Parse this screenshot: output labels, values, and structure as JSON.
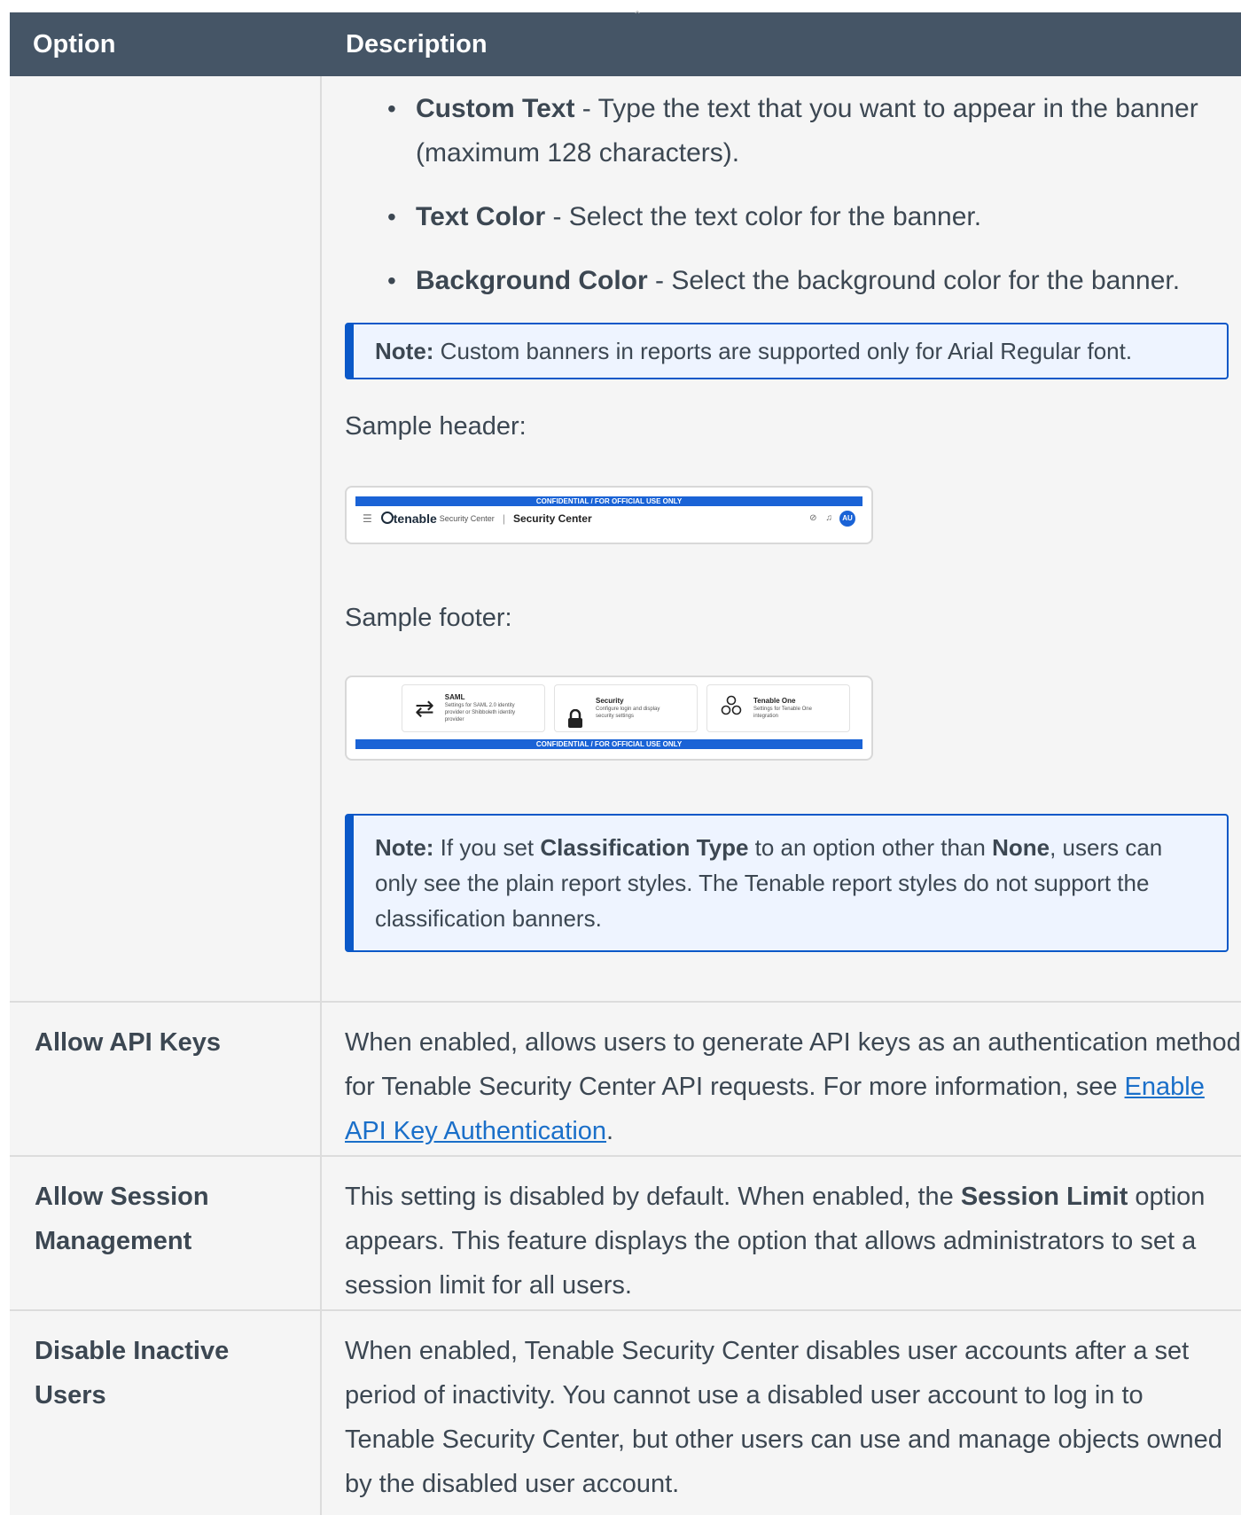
{
  "table": {
    "headers": {
      "option": "Option",
      "description": "Description"
    },
    "banner_row": {
      "bullets": [
        {
          "term": "Custom Text",
          "text": " - Type the text that you want to appear in the banner (maximum 128 characters)."
        },
        {
          "term": "Text Color",
          "text": " - Select the text color for the banner."
        },
        {
          "term": "Background Color",
          "text": " - Select the background color for the banner."
        }
      ],
      "note1": {
        "label": "Note:",
        "text": " Custom banners in reports are supported only for Arial Regular font."
      },
      "sample_header_label": "Sample header:",
      "sample_header": {
        "banner": "CONFIDENTIAL / FOR OFFICIAL USE ONLY",
        "brand": "tenable",
        "brand_sub": "Security Center",
        "app_title": "Security Center",
        "avatar": "AU"
      },
      "sample_footer_label": "Sample footer:",
      "sample_footer": {
        "banner": "CONFIDENTIAL / FOR OFFICIAL USE ONLY",
        "cards": [
          {
            "title": "SAML",
            "desc": "Settings for SAML 2.0 identity provider or Shibboleth identity provider",
            "icon": "swap-arrows-icon"
          },
          {
            "title": "Security",
            "desc": "Configure login and display security settings",
            "icon": "lock-icon"
          },
          {
            "title": "Tenable One",
            "desc": "Settings for Tenable One integration",
            "icon": "hexagons-icon"
          }
        ]
      },
      "note2": {
        "label": "Note:",
        "t1": " If you set ",
        "b1": "Classification Type",
        "t2": " to an option other than ",
        "b2": "None",
        "t3": ", users can only see the plain report styles. The Tenable report styles do not support the classification banners."
      }
    },
    "rows": [
      {
        "option": "Allow API Keys",
        "desc_pre": "When enabled, allows users to generate API keys as an authentication method for Tenable Security Center API requests. For more information, see ",
        "link": "Enable API Key Authentication",
        "desc_post": "."
      },
      {
        "option": "Allow Session Management",
        "desc_pre": "This setting is disabled by default. When enabled, the ",
        "bold": "Session Limit",
        "desc_post": " option appears. This feature displays the option that allows administrators to set a session limit for all users."
      },
      {
        "option": "Disable Inactive Users",
        "desc": "When enabled, Tenable Security Center disables user accounts after a set period of inactivity. You cannot use a disabled user account to log in to Tenable Security Center, but other users can use and manage objects owned by the disabled user account."
      }
    ]
  },
  "colors": {
    "header_bg": "#455566",
    "accent": "#0a58c8",
    "link": "#1a6fc9",
    "row_bg": "#f5f5f5"
  }
}
